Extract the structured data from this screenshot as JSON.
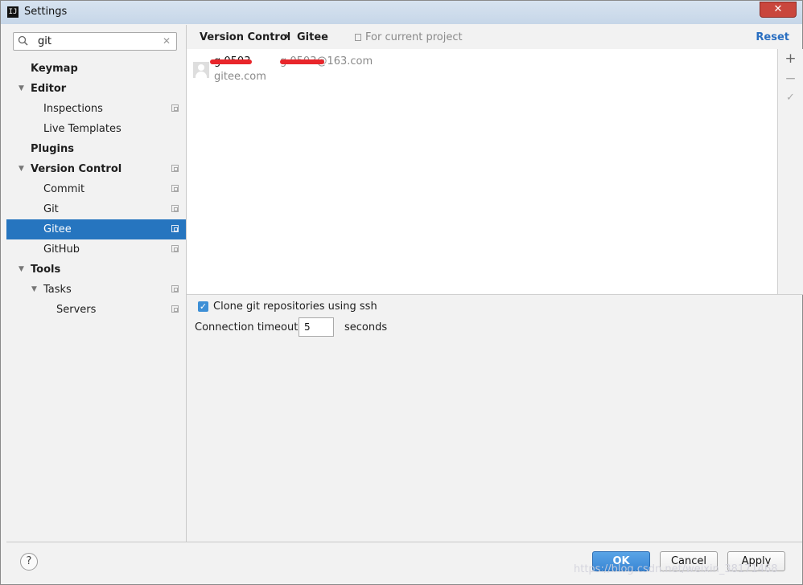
{
  "window": {
    "title": "Settings",
    "app_icon": "IJ"
  },
  "sidebar": {
    "search": {
      "value": "git",
      "placeholder": ""
    },
    "items": [
      {
        "label": "Keymap",
        "bold": true
      },
      {
        "label": "Editor",
        "bold": true
      },
      {
        "label": "Inspections"
      },
      {
        "label": "Live Templates"
      },
      {
        "label": "Plugins",
        "bold": true
      },
      {
        "label": "Version Control",
        "bold": true
      },
      {
        "label": "Commit"
      },
      {
        "label": "Git"
      },
      {
        "label": "Gitee",
        "selected": true
      },
      {
        "label": "GitHub"
      },
      {
        "label": "Tools",
        "bold": true
      },
      {
        "label": "Tasks"
      },
      {
        "label": "Servers"
      }
    ]
  },
  "header": {
    "breadcrumb_parent": "Version Control",
    "breadcrumb_separator": "›",
    "breadcrumb_current": "Gitee",
    "scope_label": "For current project",
    "reset_label": "Reset"
  },
  "accounts": [
    {
      "name": "g      0503",
      "email": "g      0503@163.com",
      "server": "gitee.com"
    }
  ],
  "toolbar": {
    "add": "+",
    "remove": "−",
    "apply": "✓"
  },
  "options": {
    "clone_ssh_label": "Clone git repositories using ssh",
    "clone_ssh_checked": true,
    "timeout_label": "Connection timeout:",
    "timeout_value": "5",
    "timeout_unit": "seconds"
  },
  "footer": {
    "help": "?",
    "ok": "OK",
    "cancel": "Cancel",
    "apply": "Apply"
  },
  "watermark": "https://blog.csdn.net/weixin_38171468",
  "colors": {
    "selection": "#2675bf",
    "ok_button": "#3a87d5",
    "link": "#2a6fc1"
  }
}
